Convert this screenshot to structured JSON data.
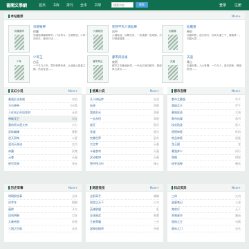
{
  "header": {
    "logo": "書閣文學網",
    "nav": [
      "首页",
      "书库",
      "排行",
      "全本",
      "书架"
    ],
    "search_placeholder": "搜索书名",
    "search_button": "搜索",
    "login": "登录",
    "register": "注册"
  },
  "featured": {
    "title": "本站推荐",
    "more": "More+",
    "books": [
      {
        "cover": "剑道独神",
        "title": "剑道独神",
        "author": "徐赢",
        "desc": "剑道独神最新章节，门派争斗，江湖恩怨，少年一剑问天，破尽万法……"
      },
      {
        "cover": "六道轮回",
        "title": "轮回不灭六道仙尊",
        "author": "风中",
        "desc": "六道轮回，仙尊归来，一念成魔一念成佛，万界之中唯我独尊……"
      },
      {
        "cover": "仙魔道",
        "title": "仙魔道",
        "author": "神机",
        "desc": "仙魔同修，逆天而行，世间大道三千，唯取其一，问鼎九霄……"
      },
      {
        "cover": "少年",
        "title": "少年王",
        "author": "白云",
        "desc": "一个平凡少年，意外获得传承，从此踏上强者之路，热血征途……"
      },
      {
        "cover": "都市风云",
        "title": "都市风云录",
        "author": "夜雨",
        "desc": "都市之中藏龙卧虎，一代兵王回归都市，掀起一场风云变幻……"
      },
      {
        "cover": "天道",
        "title": "天道",
        "author": "青山",
        "desc": "天道无情，人心有情，一介凡人，逆天改命，登临绝顶……"
      }
    ]
  },
  "lists": [
    {
      "title": "玄幻小说",
      "more": "More+",
      "rows": [
        {
          "title": "最强反派系统",
          "author": "文伯"
        },
        {
          "title": "万古神帝",
          "author": "飞天鱼"
        },
        {
          "title": "人在玄幻开局签到",
          "author": "无名"
        },
        {
          "title": "神级龙卫",
          "author": "风云"
        },
        {
          "title": "我的师父是大帝",
          "author": "小七"
        },
        {
          "title": "武炼巅峰",
          "author": "莫默"
        },
        {
          "title": "逆天邪神",
          "author": "火星"
        },
        {
          "title": "混沌天帝诀",
          "author": "古月"
        },
        {
          "title": "帝霸",
          "author": "厌笔"
        },
        {
          "title": "元尊",
          "author": "天蚕"
        },
        {
          "title": "绝世武神",
          "author": "净无"
        }
      ]
    },
    {
      "title": "修真小说",
      "more": "More+",
      "rows": [
        {
          "title": "凡人修仙传",
          "author": "忘语"
        },
        {
          "title": "仙逆",
          "author": "耳根"
        },
        {
          "title": "我欲封天",
          "author": "耳根"
        },
        {
          "title": "一念永恒",
          "author": "耳根"
        },
        {
          "title": "遮天",
          "author": "辰东"
        },
        {
          "title": "圣墟",
          "author": "辰东"
        },
        {
          "title": "完美世界",
          "author": "辰东"
        },
        {
          "title": "大主宰",
          "author": "天蚕"
        },
        {
          "title": "斗破苍穹",
          "author": "天蚕"
        },
        {
          "title": "武动乾坤",
          "author": "天蚕"
        },
        {
          "title": "雪中悍刀行",
          "author": "烽火"
        }
      ]
    },
    {
      "title": "都市言情",
      "more": "More+",
      "rows": [
        {
          "title": "都市之最强",
          "author": "木子"
        },
        {
          "title": "超级兵王",
          "author": "步千"
        },
        {
          "title": "最强医圣",
          "author": "大海"
        },
        {
          "title": "都市仙尊",
          "author": "洛书"
        },
        {
          "title": "校花贴身",
          "author": "鱼人"
        },
        {
          "title": "透视神医",
          "author": "秋风"
        },
        {
          "title": "绝品神医",
          "author": "逍遥"
        },
        {
          "title": "龙王殿",
          "author": "龙"
        },
        {
          "title": "最强弃少",
          "author": "风行"
        },
        {
          "title": "赘婿",
          "author": "愤怒"
        },
        {
          "title": "修罗战神",
          "author": "善良"
        }
      ]
    },
    {
      "title": "历史军事",
      "more": "More+",
      "rows": [
        {
          "title": "明朝那些事",
          "author": "当年"
        },
        {
          "title": "庆余年",
          "author": "猫腻"
        },
        {
          "title": "唐砖",
          "author": "孑与"
        },
        {
          "title": "回到明朝",
          "author": "月关"
        },
        {
          "title": "大秦帝国",
          "author": "孙皓"
        },
        {
          "title": "三国之召唤",
          "author": "无名"
        }
      ]
    },
    {
      "title": "网游竞技",
      "more": "More+",
      "rows": [
        {
          "title": "全职高手",
          "author": "蝴蝶"
        },
        {
          "title": "网游之天下",
          "author": "小刀"
        },
        {
          "title": "英雄联盟",
          "author": "乱"
        },
        {
          "title": "全球高武",
          "author": "老鹰"
        },
        {
          "title": "王者荣耀",
          "author": "三分"
        },
        {
          "title": "超神机械师",
          "author": "齐佩"
        }
      ]
    },
    {
      "title": "科幻灵异",
      "more": "More+",
      "rows": [
        {
          "title": "三体",
          "author": "大刘"
        },
        {
          "title": "盗墓笔记",
          "author": "三叔"
        },
        {
          "title": "鬼吹灯",
          "author": "天下"
        },
        {
          "title": "吞噬星空",
          "author": "番茄"
        },
        {
          "title": "诡秘之主",
          "author": "乌贼"
        },
        {
          "title": "星际之门",
          "author": "无名"
        }
      ]
    }
  ]
}
